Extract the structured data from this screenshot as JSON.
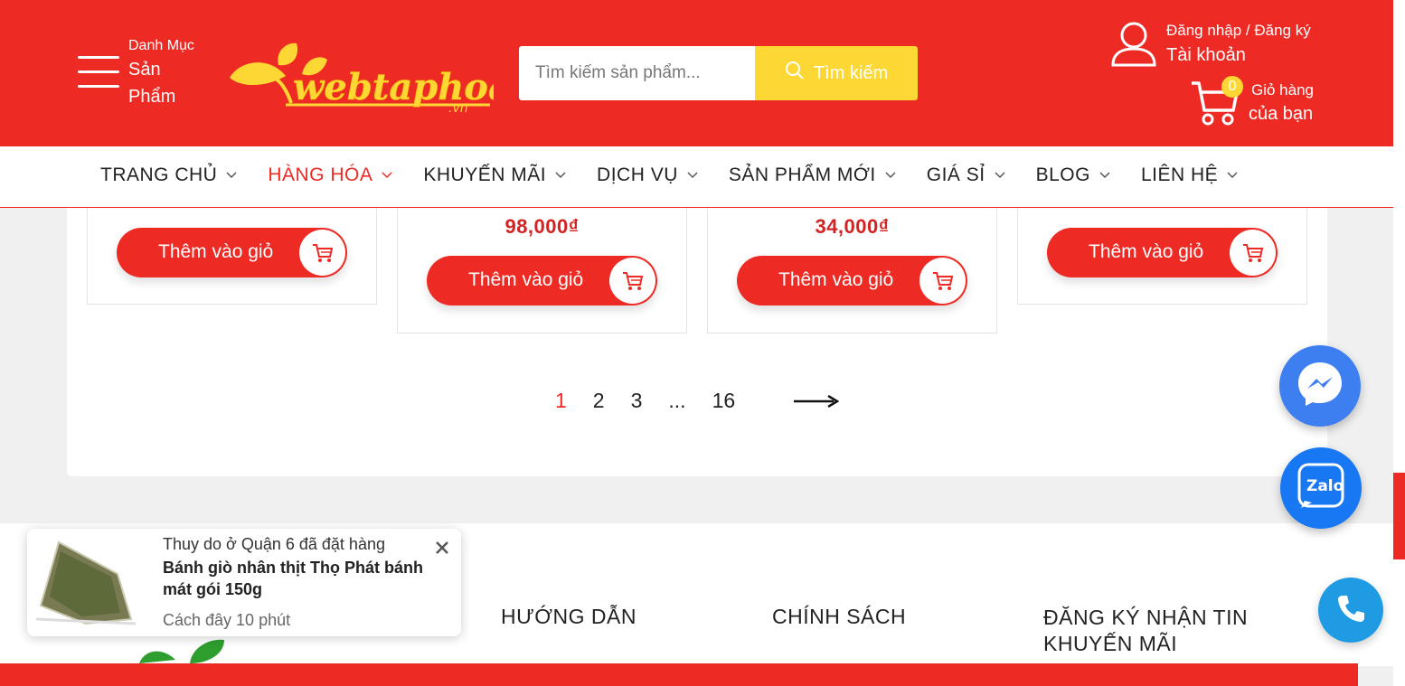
{
  "colors": {
    "brand_red": "#ee2a24",
    "accent_yellow": "#fdd835",
    "price_red": "#d32222"
  },
  "header": {
    "menu": {
      "small": "Danh Mục",
      "big": "Sản Phẩm",
      "icon": "hamburger-icon"
    },
    "logo_text": "webtaphoa",
    "logo_suffix": ".vn",
    "search": {
      "placeholder": "Tìm kiếm sản phẩm...",
      "button": "Tìm kiếm"
    },
    "account": {
      "line1": "Đăng nhập / Đăng ký",
      "line2": "Tài khoản"
    },
    "cart": {
      "count": "0",
      "line1": "Giỏ hàng",
      "line2": "của bạn"
    }
  },
  "nav": {
    "items": [
      {
        "label": "TRANG CHỦ",
        "active": false
      },
      {
        "label": "HÀNG HÓA",
        "active": true
      },
      {
        "label": "KHUYẾN MÃI",
        "active": false
      },
      {
        "label": "DỊCH VỤ",
        "active": false
      },
      {
        "label": "SẢN PHẨM MỚI",
        "active": false
      },
      {
        "label": "GIÁ SỈ",
        "active": false
      },
      {
        "label": "BLOG",
        "active": false
      },
      {
        "label": "LIÊN HỆ",
        "active": false
      }
    ]
  },
  "products": [
    {
      "price": "",
      "button": "Thêm vào giỏ"
    },
    {
      "price": "98,000₫",
      "button": "Thêm vào giỏ"
    },
    {
      "price": "34,000₫",
      "button": "Thêm vào giỏ"
    },
    {
      "price": "",
      "button": "Thêm vào giỏ"
    }
  ],
  "pagination": {
    "pages": [
      "1",
      "2",
      "3",
      "...",
      "16"
    ],
    "current": "1"
  },
  "footer": {
    "headings": [
      "HƯỚNG DẪN",
      "CHÍNH SÁCH",
      "ĐĂNG KÝ NHẬN TIN KHUYẾN MÃI"
    ]
  },
  "toast": {
    "who": "Thuy do ở Quận 6 đã đặt hàng",
    "product": "Bánh giò nhân thịt Thọ Phát bánh mát gói 150g",
    "ago": "Cách đây 10 phút"
  },
  "floating": {
    "messenger": "messenger-icon",
    "zalo": "Zalo",
    "phone": "phone-icon"
  }
}
